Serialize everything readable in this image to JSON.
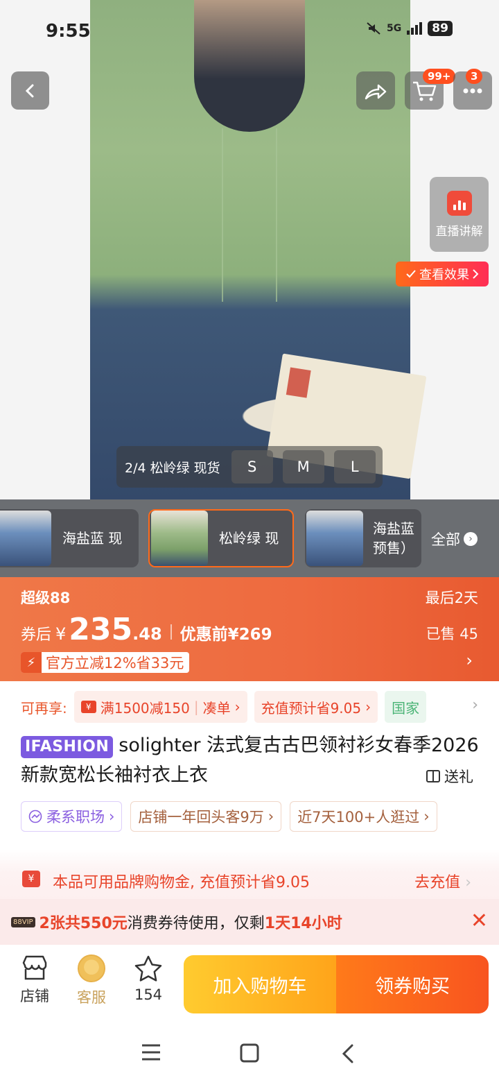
{
  "status": {
    "time": "9:55",
    "network": "5G",
    "battery": "89"
  },
  "header": {
    "cart_badge": "99+",
    "more_badge": "3"
  },
  "live": {
    "label": "直播讲解"
  },
  "effect": {
    "label": "查看效果"
  },
  "gallery": {
    "index": "2/4 松岭绿 现货",
    "sizes": [
      "S",
      "M",
      "L"
    ]
  },
  "variants": {
    "items": [
      {
        "label": "海盐蓝 现"
      },
      {
        "label": "松岭绿 现"
      },
      {
        "label": "海盐蓝\n预售）"
      }
    ],
    "all_label": "全部"
  },
  "price": {
    "tier": "超级88",
    "days_left": "最后2天",
    "after_coupon_label": "券后",
    "currency": "¥",
    "integer": "235",
    "decimal": ".48",
    "original": "优惠前¥269",
    "sold": "已售 45",
    "discount": "官方立减12%省33元"
  },
  "promos": {
    "label": "可再享:",
    "chips": [
      "满1500减150",
      "凑单",
      "充值预计省9.05",
      "国家"
    ]
  },
  "product": {
    "brand_tag": "IFASHION",
    "title": "solighter 法式复古古巴领衬衫女春季2026新款宽松长袖衬衣上衣",
    "gift_label": "送礼"
  },
  "tags": [
    "柔系职场",
    "店铺一年回头客9万",
    "近7天100+人逛过"
  ],
  "funds": {
    "text": "本品可用品牌购物金, 充值预计省9.05",
    "cta": "去充值"
  },
  "vip": {
    "tag": "88VIP",
    "count_text": "2张共550元",
    "middle_text": "消费券待使用，仅剩",
    "time_text": "1天14小时"
  },
  "bottom": {
    "shop_label": "店铺",
    "service_label": "客服",
    "fav_count": "154",
    "cart_button": "加入购物车",
    "buy_button": "领券购买"
  },
  "colors": {
    "accent": "#ee6a3f",
    "red": "#e8442a",
    "brand_purple": "#7c5ae0"
  }
}
